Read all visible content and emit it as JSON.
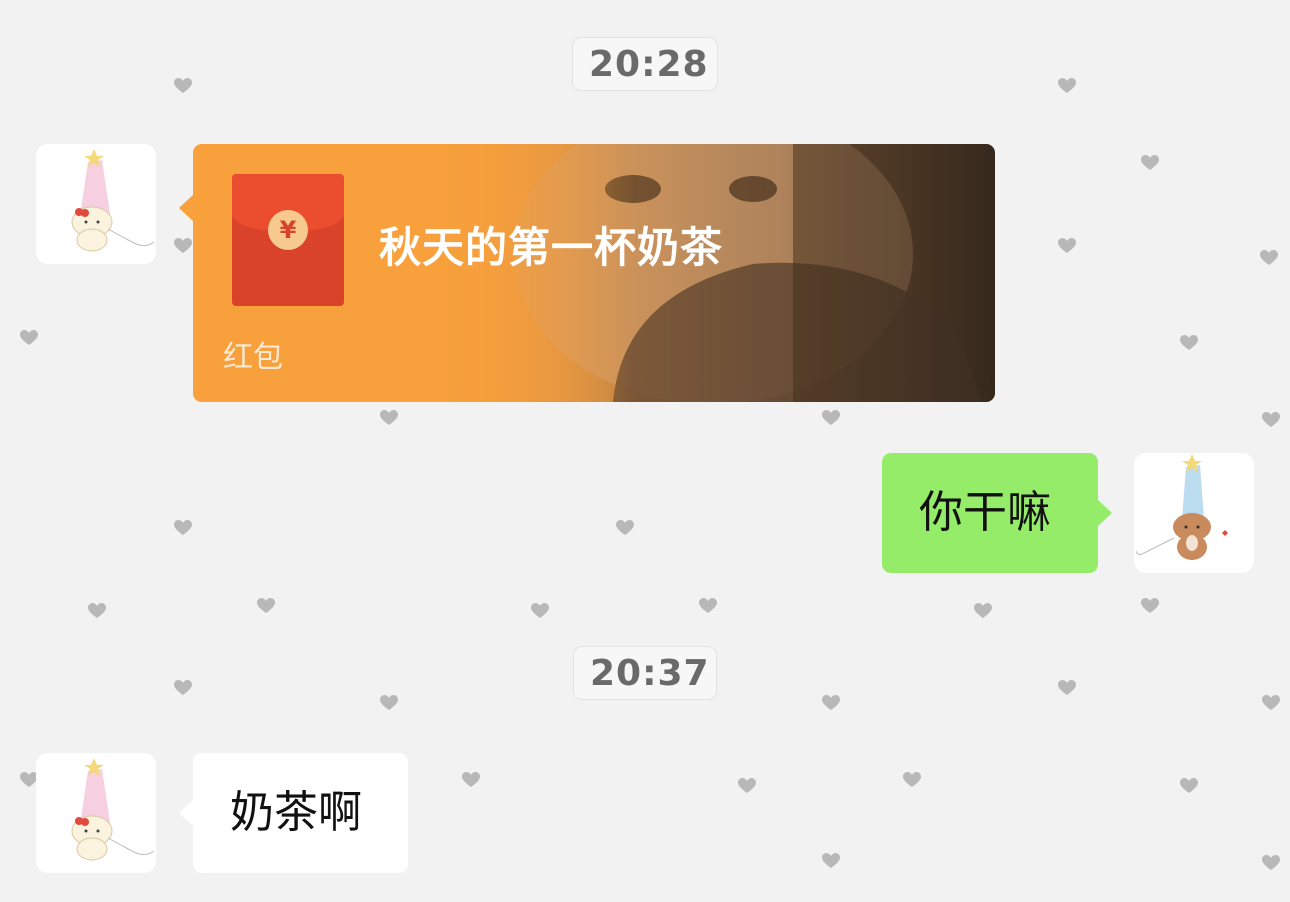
{
  "messages": [
    {
      "type": "timestamp",
      "text": "20:28"
    },
    {
      "type": "red_packet",
      "sender": "other",
      "title": "秋天的第一杯奶茶",
      "label": "红包",
      "coin_symbol": "¥"
    },
    {
      "type": "text",
      "sender": "self",
      "text": "你干嘛"
    },
    {
      "type": "timestamp",
      "text": "20:37"
    },
    {
      "type": "text",
      "sender": "other",
      "text": "奶茶啊"
    }
  ],
  "colors": {
    "background": "#f2f2f2",
    "self_bubble": "#95ec69",
    "other_bubble": "#ffffff",
    "red_packet": "#f7a03c",
    "envelope": "#d9432a"
  },
  "icons": {
    "background_pattern": "heart-icon",
    "other_avatar": "white-cat-party-hat-avatar",
    "self_avatar": "brown-cat-party-hat-avatar"
  }
}
